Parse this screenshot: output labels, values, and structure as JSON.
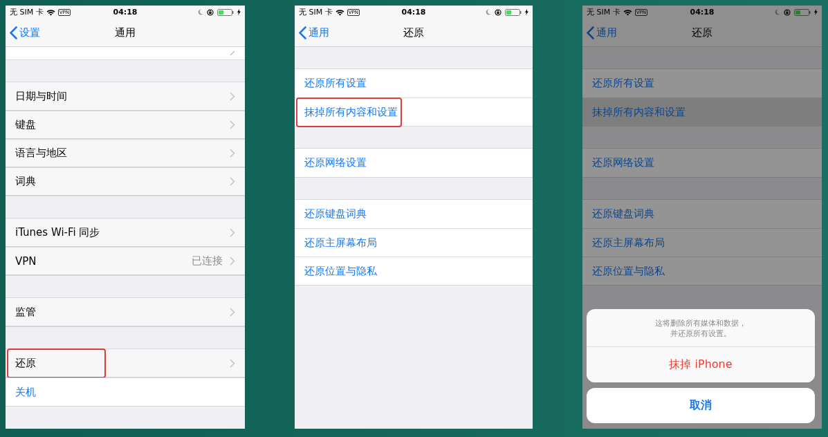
{
  "phones": [
    {
      "status": {
        "carrier": "无 SIM 卡",
        "vpn": "VPN",
        "time": "04:18"
      },
      "nav": {
        "back": "设置",
        "title": "通用"
      },
      "dimmed": false,
      "groups": [
        {
          "rows": [
            {
              "kind": "cut",
              "highlighted": false,
              "selected": false
            }
          ]
        },
        {
          "rows": [
            {
              "kind": "nav",
              "label": "日期与时间",
              "highlighted": false,
              "selected": false
            },
            {
              "kind": "nav",
              "label": "键盘",
              "highlighted": false,
              "selected": false
            },
            {
              "kind": "nav",
              "label": "语言与地区",
              "highlighted": false,
              "selected": false
            },
            {
              "kind": "nav",
              "label": "词典",
              "highlighted": false,
              "selected": false
            }
          ]
        },
        {
          "rows": [
            {
              "kind": "nav",
              "label": "iTunes Wi-Fi 同步",
              "highlighted": false,
              "selected": false
            },
            {
              "kind": "nav",
              "label": "VPN",
              "detail": "已连接",
              "highlighted": false,
              "selected": false
            }
          ]
        },
        {
          "rows": [
            {
              "kind": "nav",
              "label": "监管",
              "highlighted": false,
              "selected": false
            }
          ]
        },
        {
          "rows": [
            {
              "kind": "nav",
              "label": "还原",
              "highlighted": true,
              "selected": false
            },
            {
              "kind": "action",
              "label": "关机",
              "highlighted": false,
              "selected": false
            }
          ]
        }
      ]
    },
    {
      "status": {
        "carrier": "无 SIM 卡",
        "vpn": "VPN",
        "time": "04:18"
      },
      "nav": {
        "back": "通用",
        "title": "还原"
      },
      "dimmed": false,
      "groups": [
        {
          "rows": [
            {
              "kind": "action",
              "label": "还原所有设置",
              "highlighted": false,
              "selected": false
            },
            {
              "kind": "action",
              "label": "抹掉所有内容和设置",
              "highlighted": true,
              "selected": false
            }
          ]
        },
        {
          "rows": [
            {
              "kind": "action",
              "label": "还原网络设置",
              "highlighted": false,
              "selected": false
            }
          ]
        },
        {
          "rows": [
            {
              "kind": "action",
              "label": "还原键盘词典",
              "highlighted": false,
              "selected": false
            },
            {
              "kind": "action",
              "label": "还原主屏幕布局",
              "highlighted": false,
              "selected": false
            },
            {
              "kind": "action",
              "label": "还原位置与隐私",
              "highlighted": false,
              "selected": false
            }
          ]
        }
      ]
    },
    {
      "status": {
        "carrier": "无 SIM 卡",
        "vpn": "VPN",
        "time": "04:18"
      },
      "nav": {
        "back": "通用",
        "title": "还原"
      },
      "dimmed": true,
      "groups": [
        {
          "rows": [
            {
              "kind": "action",
              "label": "还原所有设置",
              "highlighted": false,
              "selected": false
            },
            {
              "kind": "action",
              "label": "抹掉所有内容和设置",
              "highlighted": false,
              "selected": true
            }
          ]
        },
        {
          "rows": [
            {
              "kind": "action",
              "label": "还原网络设置",
              "highlighted": false,
              "selected": false
            }
          ]
        },
        {
          "rows": [
            {
              "kind": "action",
              "label": "还原键盘词典",
              "highlighted": false,
              "selected": false
            },
            {
              "kind": "action",
              "label": "还原主屏幕布局",
              "highlighted": false,
              "selected": false
            },
            {
              "kind": "action",
              "label": "还原位置与隐私",
              "highlighted": false,
              "selected": false
            }
          ]
        }
      ],
      "sheet": {
        "message": [
          "这将删除所有媒体和数据，",
          "并还原所有设置。"
        ],
        "destructive": "抹掉 iPhone",
        "cancel": "取消"
      }
    }
  ]
}
